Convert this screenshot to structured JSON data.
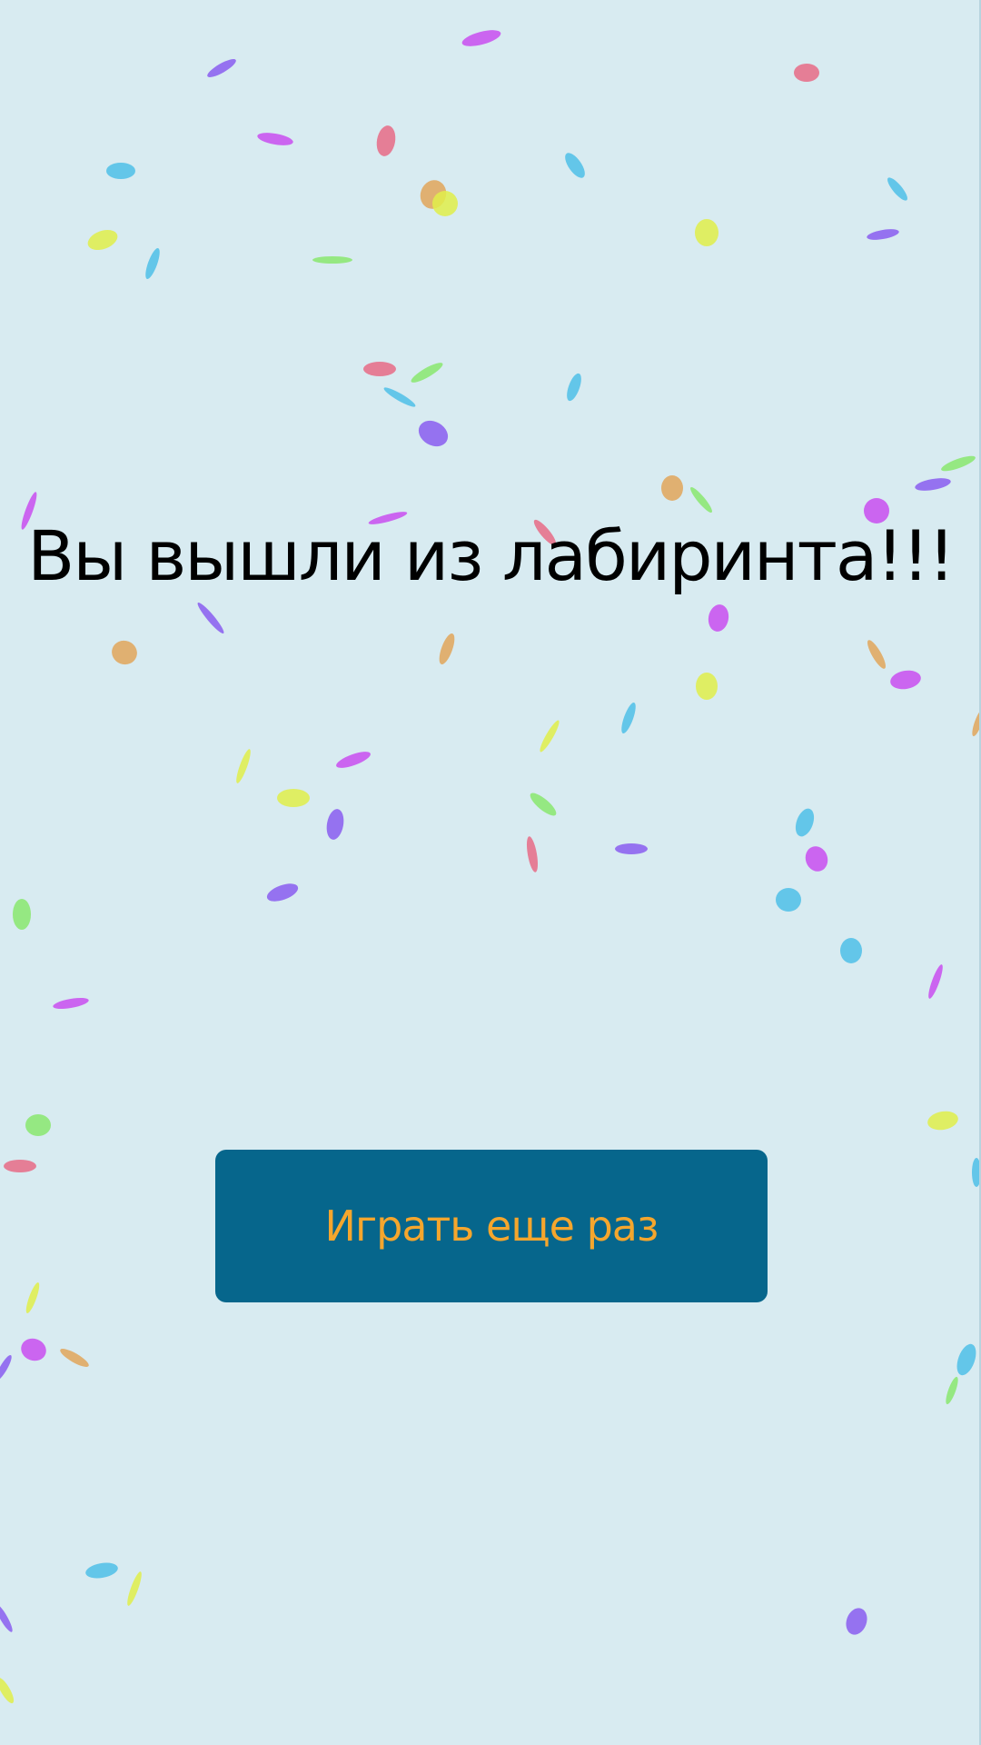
{
  "screen": {
    "background_color": "#d8ebf1",
    "message": "Вы вышли из лабиринта!!!",
    "play_again_label": "Играть еще раз",
    "button_color": "#06668c",
    "button_text_color": "#f5a62d"
  },
  "confetti": {
    "palette": [
      "#c94df0",
      "#4fbfe8",
      "#e86b86",
      "#e0ee4a",
      "#89e86f",
      "#8a5df0",
      "#e2a65a"
    ]
  }
}
